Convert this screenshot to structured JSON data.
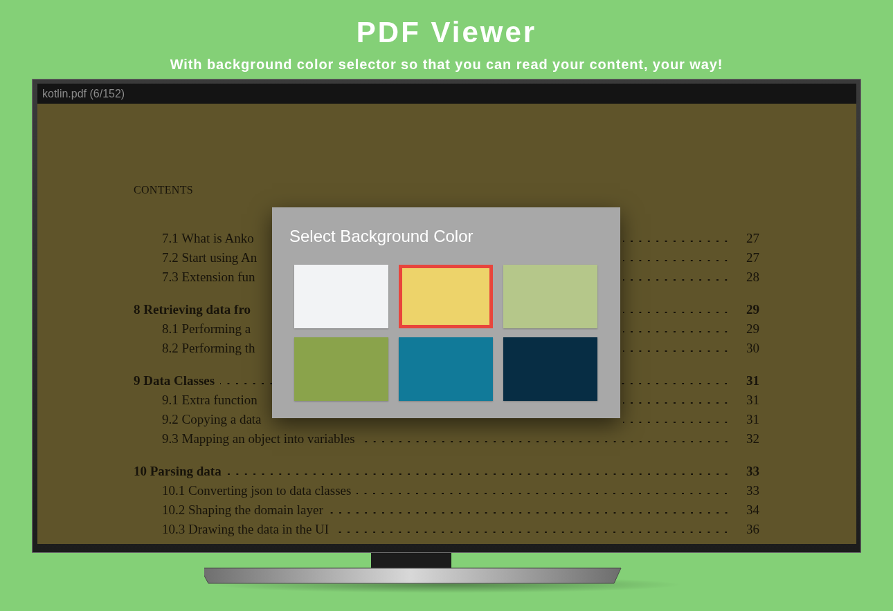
{
  "banner": {
    "title": "PDF Viewer",
    "subtitle": "With background color selector so that you can read your content, your way!"
  },
  "viewer": {
    "title_bar": "kotlin.pdf (6/152)",
    "page": {
      "heading": "CONTENTS",
      "groups": [
        {
          "entries": [
            {
              "kind": "section",
              "text": "7.1 What is Anko",
              "page": "27",
              "covered": true
            },
            {
              "kind": "section",
              "text": "7.2 Start using An",
              "page": "27",
              "covered": true
            },
            {
              "kind": "section",
              "text": "7.3 Extension fun",
              "page": "28",
              "covered": true
            }
          ]
        },
        {
          "entries": [
            {
              "kind": "chapter",
              "text": "8 Retrieving data fro",
              "page": "29",
              "covered": true
            },
            {
              "kind": "section",
              "text": "8.1 Performing a",
              "page": "29",
              "covered": true
            },
            {
              "kind": "section",
              "text": "8.2 Performing th",
              "page": "30",
              "covered": true
            }
          ]
        },
        {
          "entries": [
            {
              "kind": "chapter",
              "text": "9 Data Classes",
              "page": "31",
              "covered": false
            },
            {
              "kind": "section",
              "text": "9.1 Extra function",
              "page": "31",
              "covered": true
            },
            {
              "kind": "section",
              "text": "9.2 Copying a data",
              "page": "31",
              "covered": true
            },
            {
              "kind": "section",
              "text": "9.3 Mapping an object into variables",
              "page": "32",
              "covered": false
            }
          ]
        },
        {
          "entries": [
            {
              "kind": "chapter",
              "text": "10 Parsing data",
              "page": "33",
              "covered": false
            },
            {
              "kind": "section",
              "text": "10.1 Converting json to data classes",
              "page": "33",
              "covered": false
            },
            {
              "kind": "section",
              "text": "10.2 Shaping the domain layer",
              "page": "34",
              "covered": false
            },
            {
              "kind": "section",
              "text": "10.3 Drawing the data in the UI",
              "page": "36",
              "covered": false
            }
          ]
        }
      ]
    }
  },
  "dialog": {
    "title": "Select Background Color",
    "swatches": [
      {
        "color": "#f2f3f5",
        "selected": false
      },
      {
        "color": "#edd36a",
        "selected": true
      },
      {
        "color": "#b5c78a",
        "selected": false
      },
      {
        "color": "#8aa34b",
        "selected": false
      },
      {
        "color": "#117a99",
        "selected": false
      },
      {
        "color": "#072d44",
        "selected": false
      }
    ]
  }
}
